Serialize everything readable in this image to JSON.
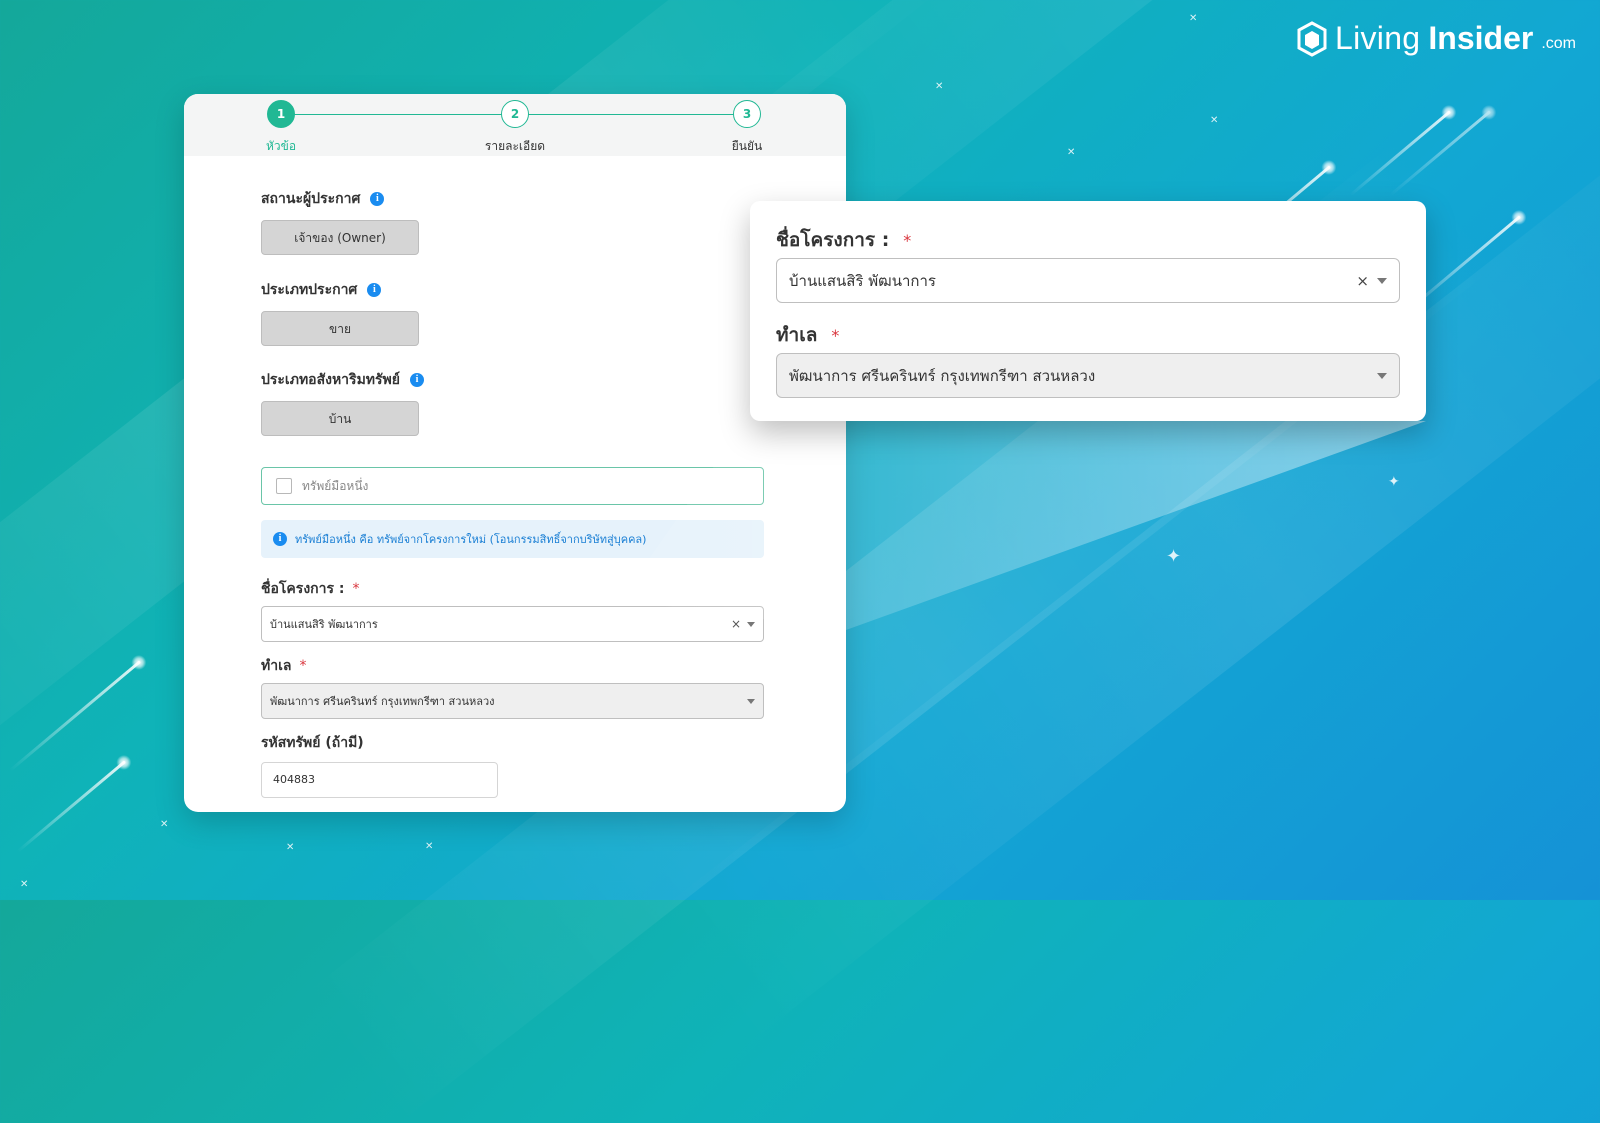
{
  "brand": {
    "living": "Living",
    "insider": "Insider",
    "dotcom": ".com"
  },
  "stepper": {
    "steps": [
      {
        "number": "1",
        "label": "หัวข้อ"
      },
      {
        "number": "2",
        "label": "รายละเอียด"
      },
      {
        "number": "3",
        "label": "ยืนยัน"
      }
    ]
  },
  "form": {
    "poster_status": {
      "title": "สถานะผู้ประกาศ",
      "value": "เจ้าของ (Owner)"
    },
    "listing_type": {
      "title": "ประเภทประกาศ",
      "value": "ขาย"
    },
    "property_type": {
      "title": "ประเภทอสังหาริมทรัพย์",
      "value": "บ้าน"
    },
    "first_hand": {
      "label": "ทรัพย์มือหนึ่ง"
    },
    "info_note": "ทรัพย์มือหนึ่ง คือ ทรัพย์จากโครงการใหม่ (โอนกรรมสิทธิ์จากบริษัทสู่บุคคล)",
    "project_name": {
      "label": "ชื่อโครงการ :",
      "required": "*",
      "value": "บ้านแสนสิริ พัฒนาการ",
      "clear": "×"
    },
    "location": {
      "label": "ทำเล",
      "required": "*",
      "value": "พัฒนาการ ศรีนครินทร์ กรุงเทพกรีฑา สวนหลวง"
    },
    "property_code": {
      "label": "รหัสทรัพย์ (ถ้ามี)",
      "value": "404883"
    }
  },
  "info_icon": "i",
  "colors": {
    "accent": "#21b894",
    "info": "#1a8cf0",
    "required": "#d9363e"
  }
}
